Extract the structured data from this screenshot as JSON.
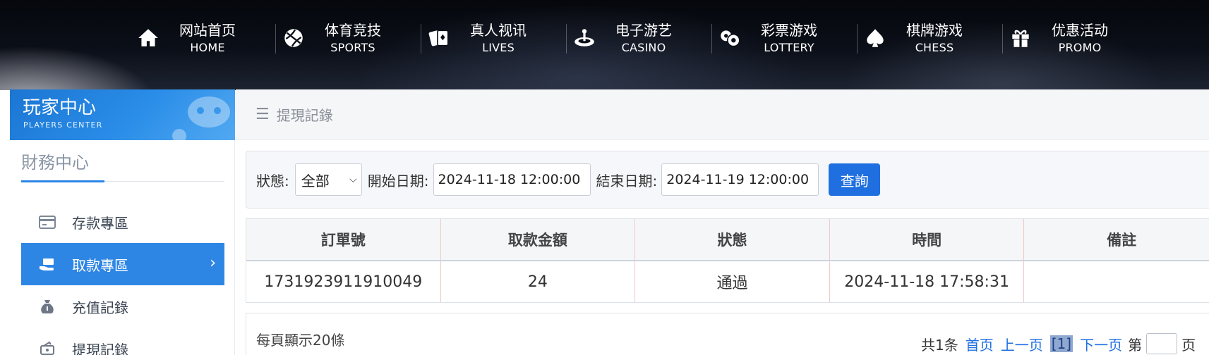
{
  "nav": [
    {
      "zh": "网站首页",
      "en": "HOME",
      "icon": "home-icon"
    },
    {
      "zh": "体育竞技",
      "en": "SPORTS",
      "icon": "ball-icon"
    },
    {
      "zh": "真人视讯",
      "en": "LIVES",
      "icon": "cards-icon"
    },
    {
      "zh": "电子游艺",
      "en": "CASINO",
      "icon": "roulette-icon"
    },
    {
      "zh": "彩票游戏",
      "en": "LOTTERY",
      "icon": "lottery-balls-icon"
    },
    {
      "zh": "棋牌游戏",
      "en": "CHESS",
      "icon": "spade-icon"
    },
    {
      "zh": "优惠活动",
      "en": "PROMO",
      "icon": "gift-icon"
    }
  ],
  "sidebar": {
    "title": "玩家中心",
    "subtitle": "PLAYERS CENTER",
    "section": "財務中心",
    "items": [
      {
        "label": "存款專區",
        "icon": "wallet-card-icon",
        "active": false
      },
      {
        "label": "取款專區",
        "icon": "cash-hand-icon",
        "active": true
      },
      {
        "label": "充值記錄",
        "icon": "money-bag-icon",
        "active": false
      },
      {
        "label": "提現記錄",
        "icon": "cash-out-icon",
        "active": false
      }
    ],
    "active_chevron": "›"
  },
  "breadcrumb": {
    "icon": "☰",
    "label": "提現記錄"
  },
  "filter": {
    "status_label": "狀態:",
    "status_value": "全部",
    "start_label": "開始日期:",
    "start_value": "2024-11-18 12:00:00",
    "end_label": "結束日期:",
    "end_value": "2024-11-19 12:00:00",
    "search_label": "查詢"
  },
  "table": {
    "headers": [
      "訂單號",
      "取款金額",
      "狀態",
      "時間",
      "備註"
    ],
    "rows": [
      [
        "1731923911910049",
        "24",
        "通過",
        "2024-11-18 17:58:31",
        ""
      ]
    ]
  },
  "pager": {
    "per_page": "每頁顯示20條",
    "total": "共1条",
    "first": "首页",
    "prev": "上一页",
    "current": "[1]",
    "next": "下一页",
    "goto_label": "第",
    "goto_suffix": "页"
  },
  "colors": {
    "accent": "#2e86e4",
    "button": "#1f6fe0"
  }
}
